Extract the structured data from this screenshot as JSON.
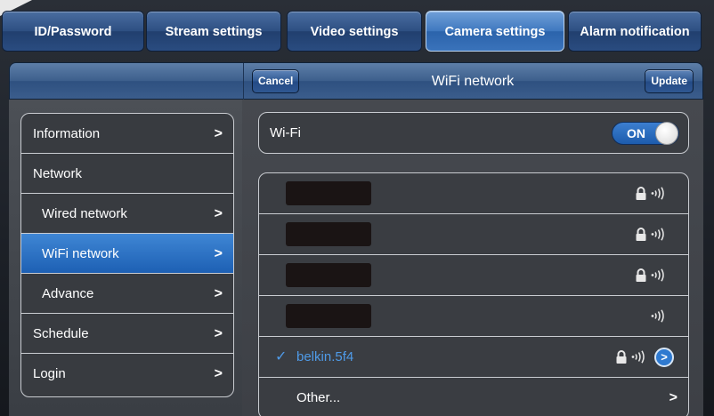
{
  "tabs": [
    {
      "label": "ID/Password"
    },
    {
      "label": "Stream settings"
    },
    {
      "label": "Video settings"
    },
    {
      "label": "Camera settings"
    },
    {
      "label": "Alarm notification"
    }
  ],
  "active_tab": "Camera settings",
  "header": {
    "cancel_label": "Cancel",
    "title": "WiFi network",
    "update_label": "Update"
  },
  "menu": {
    "items": [
      {
        "label": "Information",
        "chevron": ">"
      },
      {
        "label": "Network",
        "chevron": ""
      },
      {
        "label": "Wired network",
        "chevron": ">"
      },
      {
        "label": "WiFi network",
        "chevron": ">"
      },
      {
        "label": "Advance",
        "chevron": ">"
      },
      {
        "label": "Schedule",
        "chevron": ">"
      },
      {
        "label": "Login",
        "chevron": ">"
      }
    ],
    "selected": "WiFi network"
  },
  "wifi": {
    "label": "Wi-Fi",
    "toggle_text": "ON"
  },
  "networks": {
    "selected_name": "belkin.5f4",
    "check_glyph": "✓",
    "info_glyph": ">",
    "other_label": "Other...",
    "other_chevron": ">"
  },
  "colors": {
    "accent": "#2f7ad0",
    "selected_text": "#4f9be8"
  },
  "icons": [
    "lock-icon",
    "wifi-signal-icon",
    "info-icon",
    "chevron-right-icon",
    "checkmark-icon"
  ]
}
